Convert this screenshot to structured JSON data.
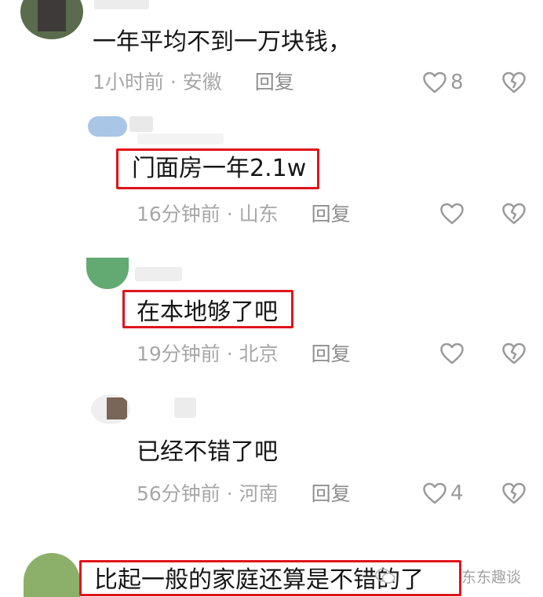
{
  "comments": [
    {
      "text": "一年平均不到一万块钱，",
      "time": "1小时前 · 安徽",
      "reply": "回复",
      "likes": "8"
    },
    {
      "text": "门面房一年2.1w",
      "time": "16分钟前 · 山东",
      "reply": "回复",
      "likes": ""
    },
    {
      "text": "在本地够了吧",
      "time": "19分钟前 · 北京",
      "reply": "回复",
      "likes": ""
    },
    {
      "text": "已经不错了吧",
      "time": "56分钟前 · 河南",
      "reply": "回复",
      "likes": "4"
    },
    {
      "text": "比起一般的家庭还算是不错的了",
      "time": "",
      "reply": "",
      "likes": ""
    }
  ],
  "watermark": {
    "text": "东东趣谈"
  },
  "colors": {
    "highlight_border": "#e0141b",
    "meta_text": "#a7a7a7",
    "icon_gray": "#9a9a9a"
  },
  "icons": [
    "heart-outline-icon",
    "broken-heart-icon",
    "wechat-logo-icon"
  ]
}
